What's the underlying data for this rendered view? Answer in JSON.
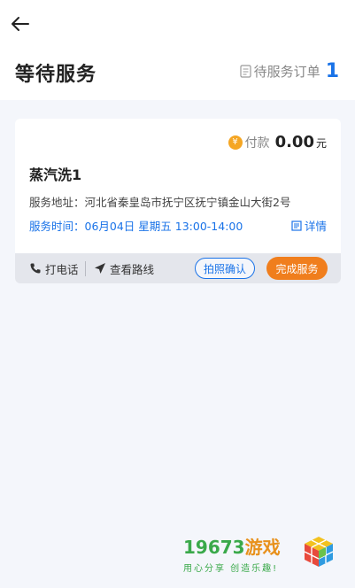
{
  "header": {
    "title": "等待服务",
    "order_label": "待服务订单",
    "order_count": "1"
  },
  "card": {
    "pay_coin": "¥",
    "pay_label": "付款",
    "pay_amount": "0.00",
    "pay_unit": "元",
    "service_name": "蒸汽洗1",
    "address": "服务地址：河北省秦皇岛市抚宁区抚宁镇金山大街2号",
    "time": "服务时间：06月04日 星期五 13:00-14:00",
    "detail_label": "详情"
  },
  "actions": {
    "call_label": "打电话",
    "route_label": "查看路线",
    "photo_label": "拍照确认",
    "finish_label": "完成服务"
  },
  "watermark": {
    "number": "19673",
    "game": "游戏",
    "slogan": "用心分享 创造乐趣!"
  },
  "colors": {
    "accent": "#1a73e8",
    "finish": "#f07e1d",
    "coin": "#f5a623"
  }
}
